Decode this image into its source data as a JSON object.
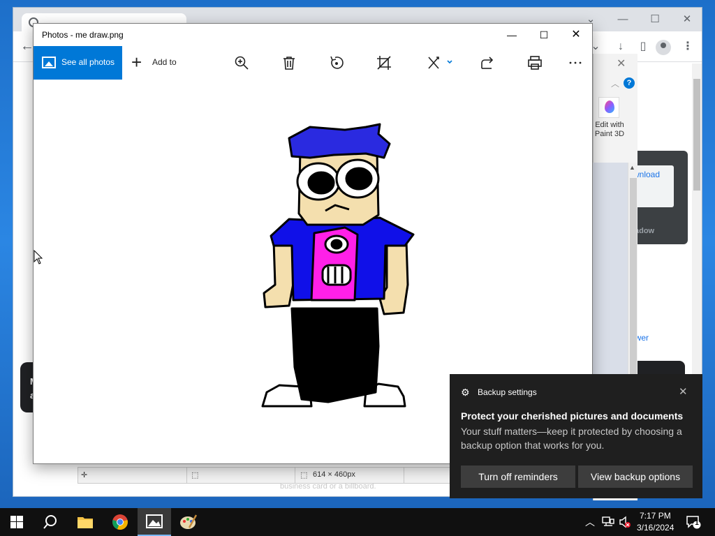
{
  "chrome": {
    "download_label": "wnload",
    "download_sub": "adow",
    "viewer_link": "ewer",
    "left_card_text": "M\na"
  },
  "paint": {
    "paint3d_label": "Edit with Paint 3D",
    "status_dimensions": "614 × 460px",
    "faded_text": "business card or a billboard."
  },
  "photos": {
    "title": "Photos - me draw.png",
    "see_all_label": "See all photos",
    "add_to_label": "Add to",
    "toolbar_icons": [
      "zoom-in-icon",
      "delete-icon",
      "rotate-icon",
      "crop-icon",
      "edit-icon",
      "share-icon",
      "print-icon",
      "more-icon"
    ]
  },
  "toast": {
    "app_name": "Backup settings",
    "title": "Protect your cherished pictures and documents",
    "body": "Your stuff matters—keep it protected by choosing a backup option that works for you.",
    "button_primary": "Turn off reminders",
    "button_secondary": "View backup options"
  },
  "taskbar": {
    "time": "7:17 PM",
    "date": "3/16/2024",
    "notification_count": "1",
    "apps": [
      "start-icon",
      "search-icon",
      "file-explorer-icon",
      "chrome-icon",
      "photos-icon",
      "paint-icon"
    ]
  },
  "colors": {
    "accent": "#0078d7",
    "toast_bg": "#1f1f1f",
    "taskbar_bg": "#101010"
  }
}
